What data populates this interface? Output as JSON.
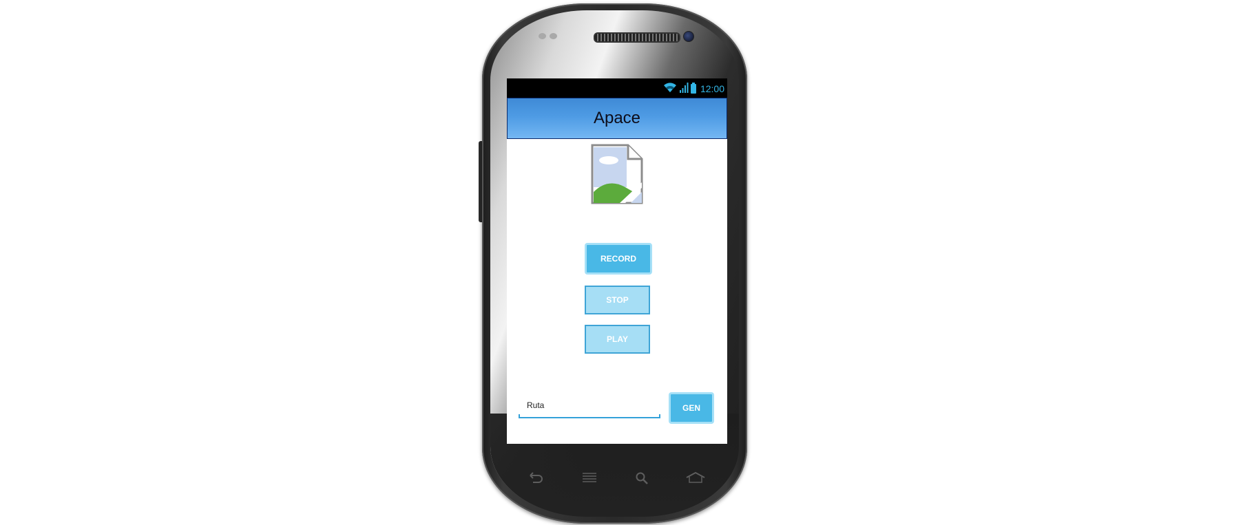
{
  "status_bar": {
    "time": "12:00",
    "icons": [
      "wifi-icon",
      "signal-icon",
      "battery-icon"
    ],
    "accent_color": "#33b5e5"
  },
  "app": {
    "title": "Apace",
    "title_bar_color": "#4e9be4"
  },
  "image": {
    "icon": "broken-image-icon"
  },
  "buttons": {
    "record": "RECORD",
    "stop": "STOP",
    "play": "PLAY",
    "gen": "GEN"
  },
  "route_input": {
    "value": "Ruta"
  },
  "nav_keys": [
    "back-icon",
    "menu-icon",
    "search-icon",
    "home-icon"
  ]
}
